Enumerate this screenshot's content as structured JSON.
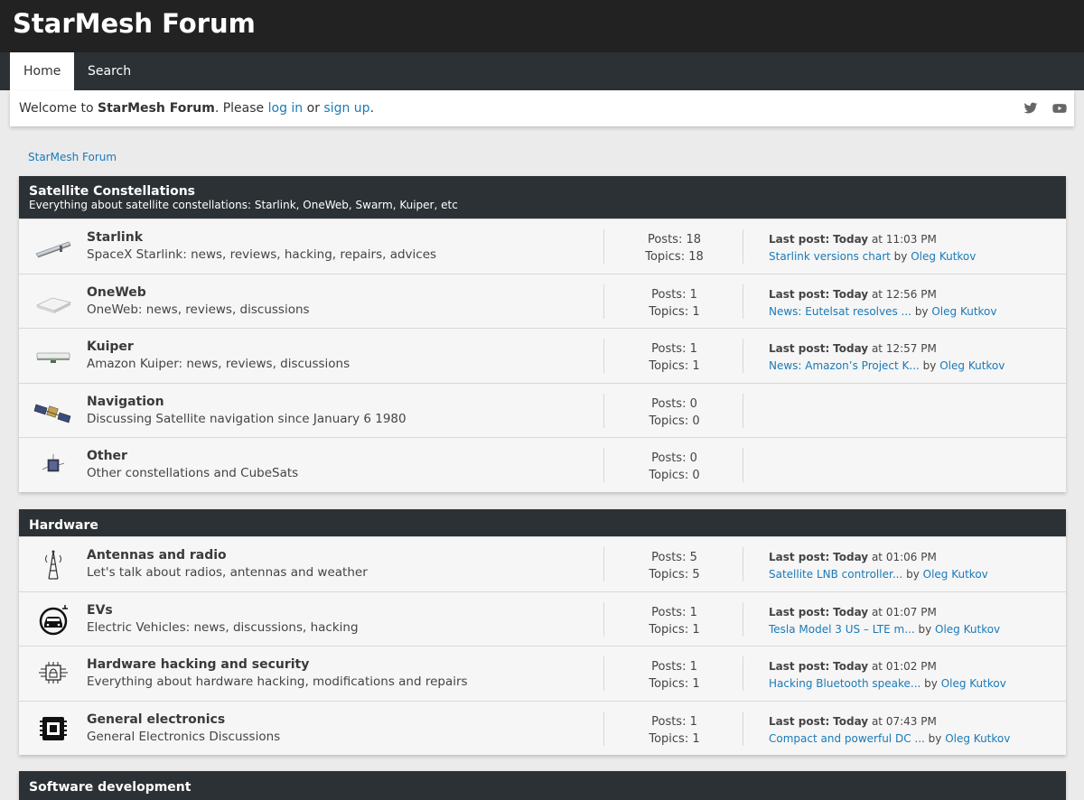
{
  "site": {
    "title": "StarMesh Forum"
  },
  "nav": {
    "tabs": [
      {
        "label": "Home"
      },
      {
        "label": "Search"
      }
    ]
  },
  "welcome": {
    "prefix": "Welcome to ",
    "site_name": "StarMesh Forum",
    "middle": ". Please ",
    "login": "log in",
    "or": " or ",
    "signup": "sign up",
    "suffix": "."
  },
  "social": {
    "icons": [
      "twitter-icon",
      "youtube-icon"
    ],
    "color": "#666666"
  },
  "breadcrumb": "StarMesh Forum",
  "labels": {
    "last_post": "Last post:",
    "at": " at ",
    "by": " by ",
    "posts": "Posts: ",
    "topics": "Topics: "
  },
  "colors": {
    "header_bg": "#222222",
    "nav_bg": "#2b3134",
    "link": "#1a7ab8",
    "page_bg": "#ebebeb"
  },
  "categories": [
    {
      "title": "Satellite Constellations",
      "desc": "Everything about satellite constellations: Starlink, OneWeb, Swarm, Kuiper, etc",
      "forums": [
        {
          "icon": "starlink-dish-icon",
          "title": "Starlink",
          "desc": "SpaceX Starlink: news, reviews, hacking, repairs, advices",
          "posts": "18",
          "topics": "18",
          "last_day": "Today",
          "last_time": "11:03 PM",
          "last_topic": "Starlink versions chart",
          "last_author": "Oleg Kutkov"
        },
        {
          "icon": "oneweb-terminal-icon",
          "title": "OneWeb",
          "desc": "OneWeb: news, reviews, discussions",
          "posts": "1",
          "topics": "1",
          "last_day": "Today",
          "last_time": "12:56 PM",
          "last_topic": "News: Eutelsat resolves ...",
          "last_author": "Oleg Kutkov"
        },
        {
          "icon": "kuiper-terminal-icon",
          "title": "Kuiper",
          "desc": "Amazon Kuiper: news, reviews, discussions",
          "posts": "1",
          "topics": "1",
          "last_day": "Today",
          "last_time": "12:57 PM",
          "last_topic": "News: Amazon’s Project K...",
          "last_author": "Oleg Kutkov"
        },
        {
          "icon": "navigation-satellite-icon",
          "title": "Navigation",
          "desc": "Discussing Satellite navigation since January 6 1980",
          "posts": "0",
          "topics": "0"
        },
        {
          "icon": "cubesat-icon",
          "title": "Other",
          "desc": "Other constellations and CubeSats",
          "posts": "0",
          "topics": "0"
        }
      ]
    },
    {
      "title": "Hardware",
      "desc": "",
      "forums": [
        {
          "icon": "antenna-tower-icon",
          "title": "Antennas and radio",
          "desc": "Let's talk about radios, antennas and weather",
          "posts": "5",
          "topics": "5",
          "last_day": "Today",
          "last_time": "01:06 PM",
          "last_topic": "Satellite LNB controller...",
          "last_author": "Oleg Kutkov"
        },
        {
          "icon": "electric-car-icon",
          "title": "EVs",
          "desc": "Electric Vehicles: news, discussions, hacking",
          "posts": "1",
          "topics": "1",
          "last_day": "Today",
          "last_time": "01:07 PM",
          "last_topic": "Tesla Model 3 US – LTE m...",
          "last_author": "Oleg Kutkov"
        },
        {
          "icon": "chip-security-icon",
          "title": "Hardware hacking and security",
          "desc": "Everything about hardware hacking, modifications and repairs",
          "posts": "1",
          "topics": "1",
          "last_day": "Today",
          "last_time": "01:02 PM",
          "last_topic": "Hacking Bluetooth speake...",
          "last_author": "Oleg Kutkov"
        },
        {
          "icon": "microchip-icon",
          "title": "General electronics",
          "desc": "General Electronics Discussions",
          "posts": "1",
          "topics": "1",
          "last_day": "Today",
          "last_time": "07:43 PM",
          "last_topic": "Compact and powerful DC ...",
          "last_author": "Oleg Kutkov"
        }
      ]
    },
    {
      "title": "Software development",
      "desc": "",
      "forums": []
    }
  ]
}
